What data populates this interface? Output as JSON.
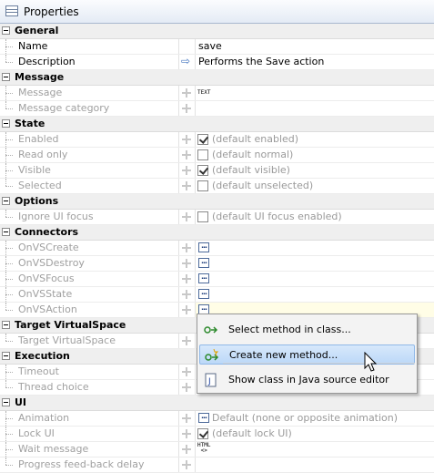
{
  "panel": {
    "title": "Properties"
  },
  "general": {
    "label": "General",
    "name": {
      "label": "Name",
      "value": "save"
    },
    "description": {
      "label": "Description",
      "value": "Performs the Save action"
    }
  },
  "message": {
    "label": "Message",
    "message": {
      "label": "Message",
      "value": "TEXT"
    },
    "category": {
      "label": "Message category"
    }
  },
  "state": {
    "label": "State",
    "enabled": {
      "label": "Enabled",
      "value": "(default enabled)",
      "checked": true
    },
    "readonly": {
      "label": "Read only",
      "value": "(default normal)",
      "checked": false
    },
    "visible": {
      "label": "Visible",
      "value": "(default visible)",
      "checked": true
    },
    "selected": {
      "label": "Selected",
      "value": "(default unselected)",
      "checked": false
    }
  },
  "options": {
    "label": "Options",
    "ignore": {
      "label": "Ignore UI focus",
      "value": "(default UI focus enabled)",
      "checked": false
    }
  },
  "connectors": {
    "label": "Connectors",
    "items": [
      "OnVSCreate",
      "OnVSDestroy",
      "OnVSFocus",
      "OnVSState",
      "OnVSAction"
    ]
  },
  "target": {
    "label": "Target VirtualSpace",
    "item": "Target VirtualSpace"
  },
  "execution": {
    "label": "Execution",
    "timeout": "Timeout",
    "thread": "Thread choice"
  },
  "ui": {
    "label": "UI",
    "animation": {
      "label": "Animation",
      "value": "Default (none or opposite animation)"
    },
    "lockui": {
      "label": "Lock UI",
      "value": "(default lock UI)",
      "checked": true
    },
    "wait": {
      "label": "Wait message",
      "value": "HTML"
    },
    "progress": {
      "label": "Progress feed-back delay"
    }
  },
  "context_menu": {
    "items": [
      "Select method in class...",
      "Create new method...",
      "Show class in Java source editor"
    ],
    "selected_index": 1
  }
}
